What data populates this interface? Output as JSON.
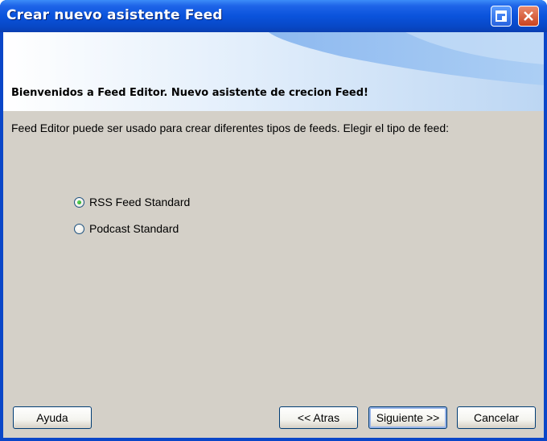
{
  "window": {
    "title": "Crear nuevo asistente Feed",
    "controls": [
      "restore-icon",
      "close-icon"
    ],
    "accent_color": "#0a53dc",
    "close_color": "#c9421f"
  },
  "banner": {
    "heading": "Bienvenidos a Feed Editor. Nuevo asistente de crecion Feed!"
  },
  "content": {
    "description": "Feed Editor puede ser usado para crear diferentes tipos de feeds. Elegir el tipo de feed:",
    "options": [
      {
        "label": "RSS Feed Standard",
        "selected": true
      },
      {
        "label": "Podcast Standard",
        "selected": false
      }
    ]
  },
  "buttons": {
    "help": "Ayuda",
    "back": "<< Atras",
    "next": "Siguiente >>",
    "cancel": "Cancelar"
  }
}
